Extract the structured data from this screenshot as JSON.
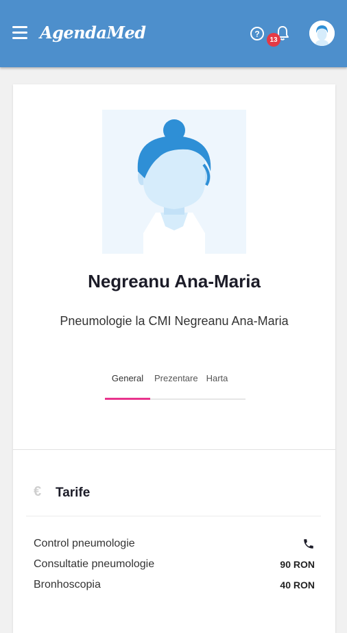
{
  "header": {
    "brand": "AgendaMed",
    "notifications_count": "13",
    "icons": {
      "menu": "hamburger-menu-icon",
      "help": "question-mark-icon",
      "notifications": "bell-icon",
      "account": "user-avatar-icon"
    },
    "colors": {
      "bar": "#4d8fcc",
      "badge": "#e53946"
    }
  },
  "profile": {
    "name": "Negreanu Ana-Maria",
    "specialty": "Pneumologie la CMI Negreanu Ana-Maria",
    "tabs": [
      {
        "label": "General",
        "active": true
      },
      {
        "label": "Prezentare",
        "active": false
      },
      {
        "label": "Harta",
        "active": false
      }
    ],
    "accent": "#e8338c"
  },
  "tarife": {
    "title": "Tarife",
    "icon": "euro-icon",
    "items": [
      {
        "name": "Control pneumologie",
        "value": "",
        "icon": "phone-icon"
      },
      {
        "name": "Consultatie pneumologie",
        "value": "90 RON"
      },
      {
        "name": "Bronhoscopia",
        "value": "40 RON"
      }
    ]
  }
}
